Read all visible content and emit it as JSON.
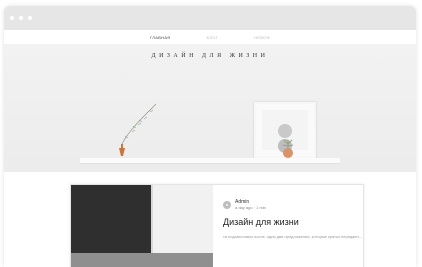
{
  "navbar": {
    "items": [
      "ГЛАВНАЯ",
      "БЛОГ",
      "НЕВОФ"
    ]
  },
  "hero": {
    "title": "ДИЗАЙН ДЛЯ ЖИЗНИ"
  },
  "post": {
    "author": "Admin",
    "info": "a day ago · 1 min",
    "title": "Дизайн для жизни",
    "excerpt": "та подзаголовок поста: одна два предложения, которые кратко передают..."
  },
  "colors": {
    "titlebar": "#e6e6e6",
    "hero_bg": "#f0f0f0",
    "chair": "#b39f80"
  }
}
